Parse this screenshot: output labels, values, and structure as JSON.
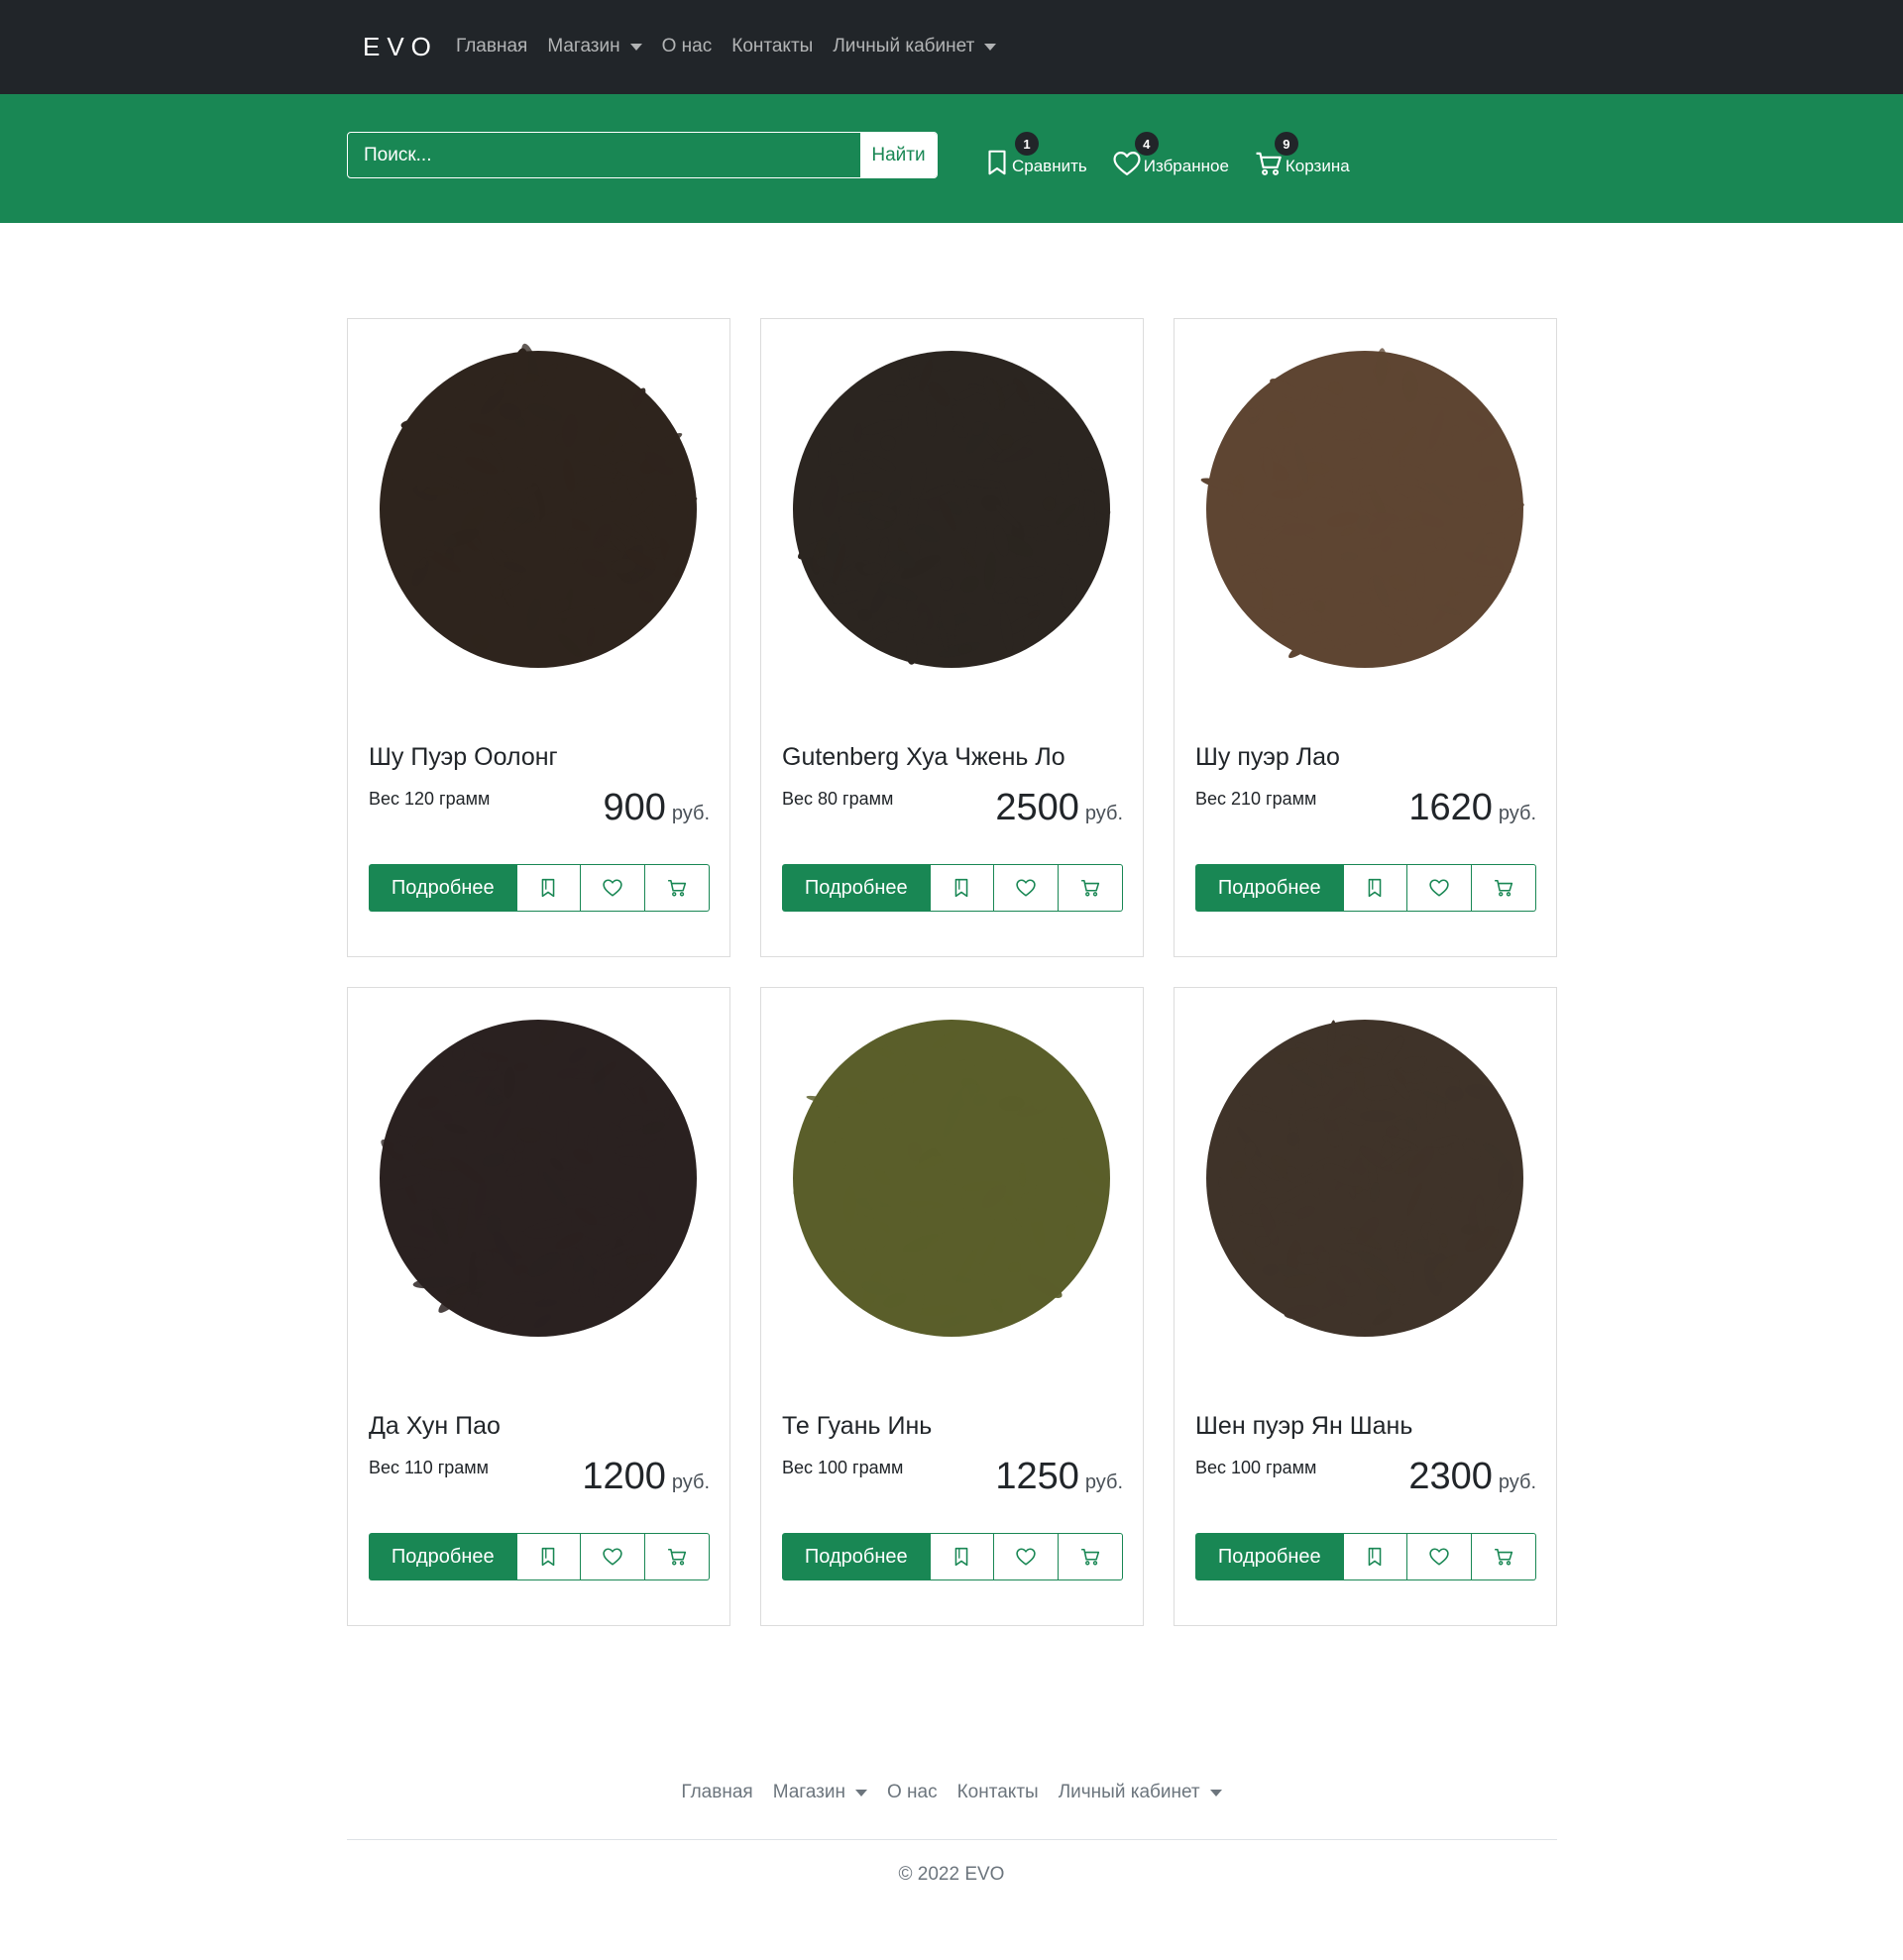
{
  "brand": "EVO",
  "nav": {
    "home": "Главная",
    "shop": "Магазин",
    "about": "О нас",
    "contacts": "Контакты",
    "account": "Личный кабинет"
  },
  "search": {
    "placeholder": "Поиск...",
    "button": "Найти"
  },
  "header_actions": {
    "compare": {
      "label": "Сравнить",
      "count": "1"
    },
    "favorites": {
      "label": "Избранное",
      "count": "4"
    },
    "cart": {
      "label": "Корзина",
      "count": "9"
    }
  },
  "product_button_label": "Подробнее",
  "products": [
    {
      "title": "Шу Пуэр Оолонг",
      "weight": "Вес 120 грамм",
      "price": "900",
      "currency": "руб.",
      "tea_color": "#2e241d"
    },
    {
      "title": "Gutenberg Хуа Чжень Ло",
      "weight": "Вес 80 грамм",
      "price": "2500",
      "currency": "руб.",
      "tea_color": "#2b2520"
    },
    {
      "title": "Шу пуэр Лао",
      "weight": "Вес 210 грамм",
      "price": "1620",
      "currency": "руб.",
      "tea_color": "#5e4532"
    },
    {
      "title": "Да Хун Пао",
      "weight": "Вес 110 грамм",
      "price": "1200",
      "currency": "руб.",
      "tea_color": "#2a2120"
    },
    {
      "title": "Те Гуань Инь",
      "weight": "Вес 100 грамм",
      "price": "1250",
      "currency": "руб.",
      "tea_color": "#5a5e2a"
    },
    {
      "title": "Шен пуэр Ян Шань",
      "weight": "Вес 100 грамм",
      "price": "2300",
      "currency": "руб.",
      "tea_color": "#3f3329"
    }
  ],
  "footer": {
    "nav": {
      "home": "Главная",
      "shop": "Магазин",
      "about": "О нас",
      "contacts": "Контакты",
      "account": "Личный кабинет"
    },
    "copyright": "© 2022 EVO"
  },
  "colors": {
    "accent": "#198754",
    "dark": "#212529"
  }
}
